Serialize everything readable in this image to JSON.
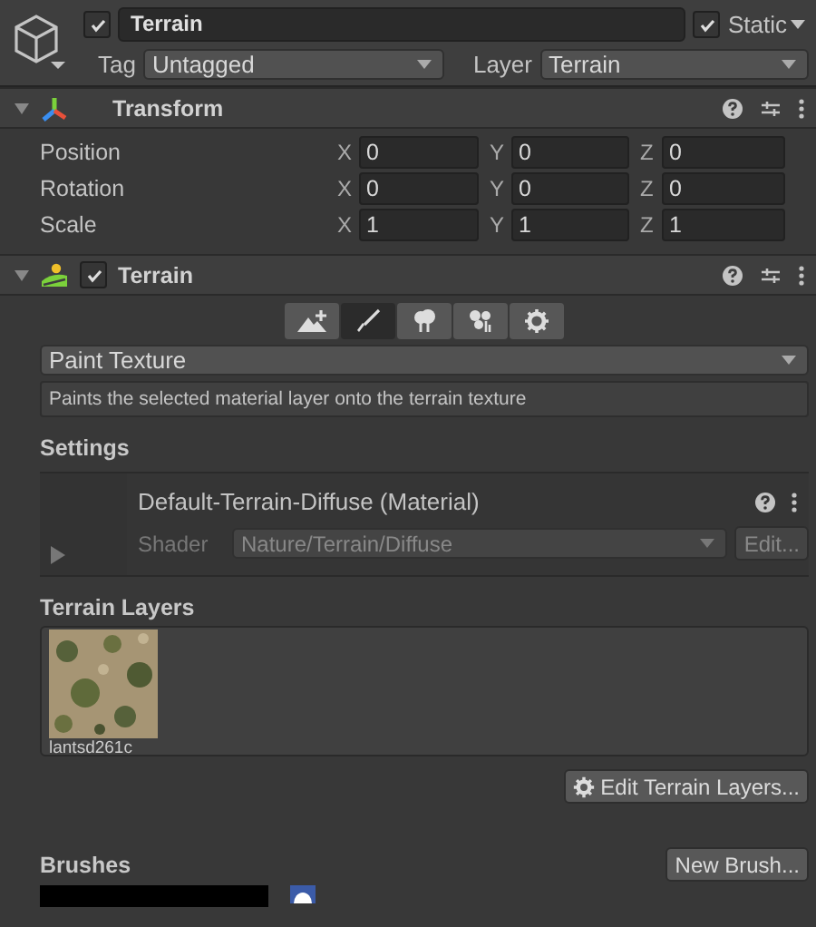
{
  "object": {
    "active": true,
    "name": "Terrain",
    "static": true,
    "static_label": "Static",
    "tag_label": "Tag",
    "tag": "Untagged",
    "layer_label": "Layer",
    "layer": "Terrain"
  },
  "transform": {
    "title": "Transform",
    "expanded": true,
    "rows": [
      {
        "label": "Position",
        "fields": [
          {
            "axis": "X",
            "value": "0"
          },
          {
            "axis": "Y",
            "value": "0"
          },
          {
            "axis": "Z",
            "value": "0"
          }
        ]
      },
      {
        "label": "Rotation",
        "fields": [
          {
            "axis": "X",
            "value": "0"
          },
          {
            "axis": "Y",
            "value": "0"
          },
          {
            "axis": "Z",
            "value": "0"
          }
        ]
      },
      {
        "label": "Scale",
        "fields": [
          {
            "axis": "X",
            "value": "1"
          },
          {
            "axis": "Y",
            "value": "1"
          },
          {
            "axis": "Z",
            "value": "1"
          }
        ]
      }
    ]
  },
  "terrain": {
    "title": "Terrain",
    "expanded": true,
    "enabled": true,
    "tools": [
      {
        "kind": "raise",
        "selected": false
      },
      {
        "kind": "paint",
        "selected": true
      },
      {
        "kind": "trees",
        "selected": false
      },
      {
        "kind": "details",
        "selected": false
      },
      {
        "kind": "settings",
        "selected": false
      }
    ],
    "mode": "Paint Texture",
    "help": "Paints the selected material layer onto the terrain texture",
    "settings_heading": "Settings",
    "material": {
      "name": "Default-Terrain-Diffuse (Material)",
      "shader_label": "Shader",
      "shader": "Nature/Terrain/Diffuse",
      "edit": "Edit..."
    },
    "layers_heading": "Terrain Layers",
    "layers": [
      {
        "kind": "picture",
        "name": "lantsd261c"
      }
    ],
    "edit_layers": "Edit Terrain Layers...",
    "brushes_heading": "Brushes",
    "new_brush": "New Brush..."
  }
}
